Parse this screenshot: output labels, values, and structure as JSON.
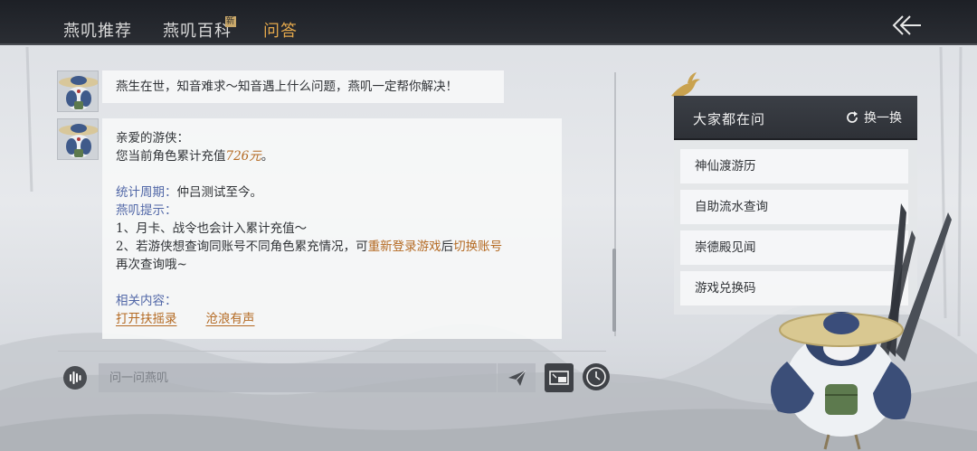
{
  "tabs": [
    {
      "label": "燕叽推荐"
    },
    {
      "label": "燕叽百科",
      "badge": "新"
    },
    {
      "label": "问答",
      "active": true
    }
  ],
  "chat": {
    "greeting": "燕生在世，知音难求～知音遇上什么问题，燕叽一定帮你解决！",
    "reply": {
      "salutation": "亲爱的游侠：",
      "recharge_prefix": "您当前角色累计充值",
      "recharge_amount": "726元",
      "recharge_suffix": "。",
      "period_label": "统计周期：",
      "period_value": "仲吕测试至今。",
      "tip_label": "燕叽提示：",
      "tip_line1": "1、月卡、战令也会计入累计充值～",
      "tip_line2_a": "2、若游侠想查询同账号不同角色累充情况，可",
      "tip_line2_b": "重新登录游戏",
      "tip_line2_c": "后",
      "tip_line2_d": "切换账号",
      "tip_line3": "再次查询哦~",
      "related_label": "相关内容：",
      "related_links": [
        "打开扶摇录",
        "沧浪有声"
      ]
    }
  },
  "input": {
    "placeholder": "问一问燕叽",
    "value": ""
  },
  "panel": {
    "title": "大家都在问",
    "refresh_label": "换一换",
    "questions": [
      "神仙渡游历",
      "自助流水查询",
      "崇德殿见闻",
      "游戏兑换码"
    ]
  },
  "colors": {
    "accent": "#e4a84c",
    "link": "#b46a23",
    "label_blue": "#5167a7",
    "topbar": "#1d2026"
  },
  "icons": {
    "back": "double-chevron-left-icon",
    "voice": "voice-wave-icon",
    "send": "paper-plane-icon",
    "screen": "screen-icon",
    "history": "clock-icon",
    "refresh": "refresh-icon"
  }
}
